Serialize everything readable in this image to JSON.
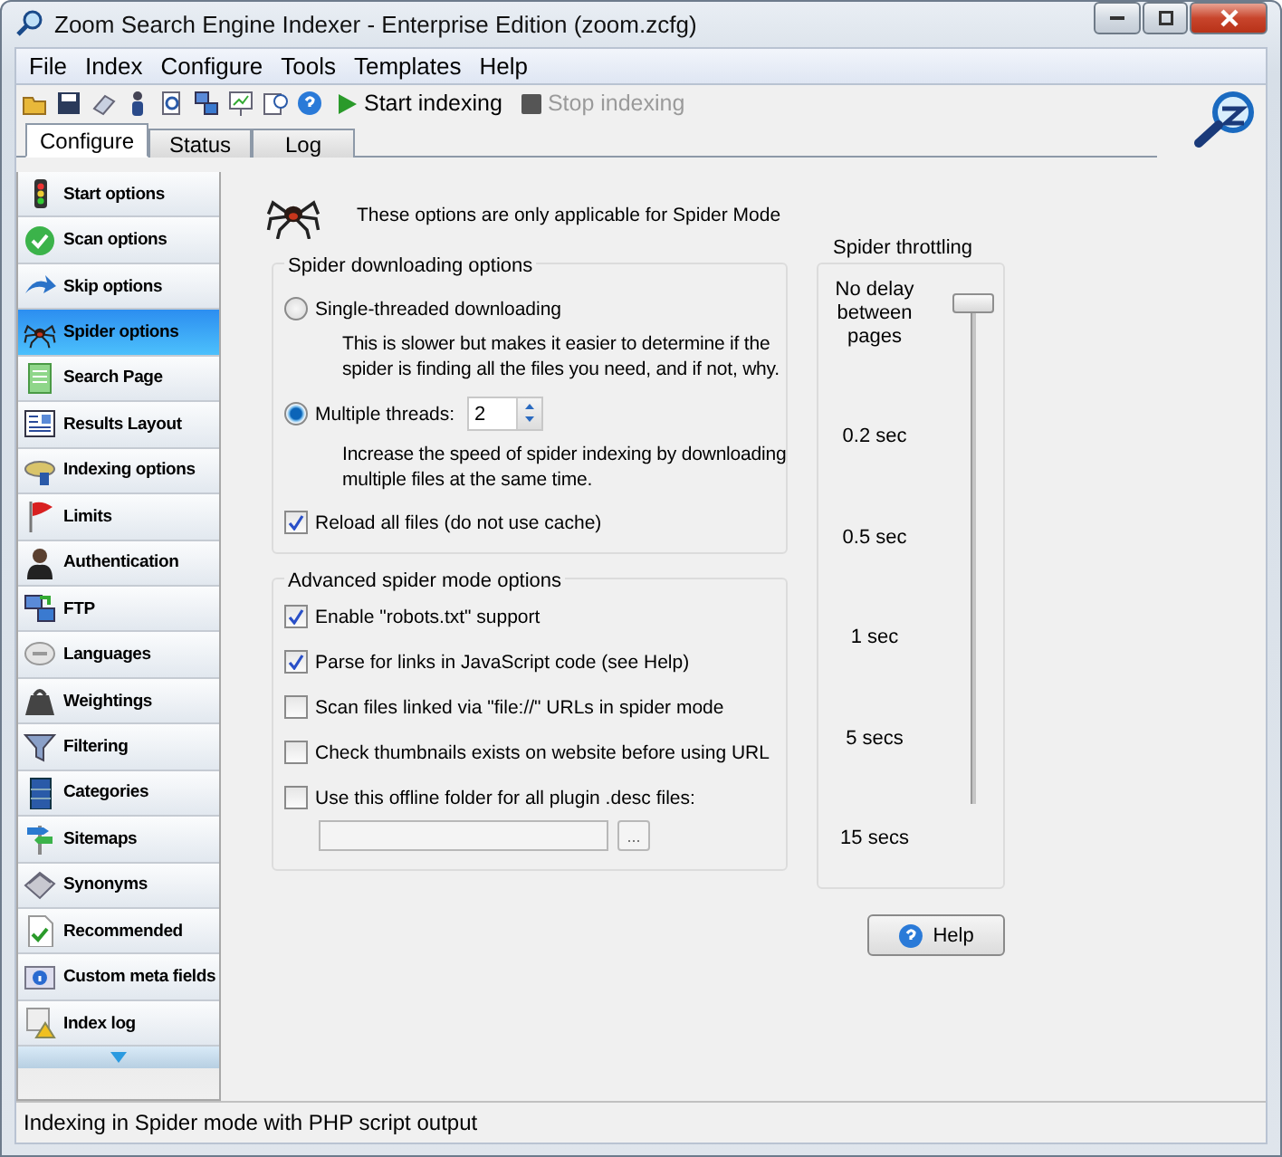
{
  "window": {
    "title": "Zoom Search Engine Indexer - Enterprise Edition (zoom.zcfg)"
  },
  "menu": [
    "File",
    "Index",
    "Configure",
    "Tools",
    "Templates",
    "Help"
  ],
  "toolbar": {
    "start": {
      "label": "Start indexing",
      "disabled": false
    },
    "stop": {
      "label": "Stop indexing",
      "disabled": true
    }
  },
  "tabs": [
    {
      "label": "Configure",
      "selected": true
    },
    {
      "label": "Status",
      "selected": false
    },
    {
      "label": "Log",
      "selected": false
    }
  ],
  "sidebar": {
    "items": [
      {
        "label": "Start options",
        "selected": false
      },
      {
        "label": "Scan options",
        "selected": false
      },
      {
        "label": "Skip options",
        "selected": false
      },
      {
        "label": "Spider options",
        "selected": true
      },
      {
        "label": "Search Page",
        "selected": false
      },
      {
        "label": "Results Layout",
        "selected": false
      },
      {
        "label": "Indexing options",
        "selected": false
      },
      {
        "label": "Limits",
        "selected": false
      },
      {
        "label": "Authentication",
        "selected": false
      },
      {
        "label": "FTP",
        "selected": false
      },
      {
        "label": "Languages",
        "selected": false
      },
      {
        "label": "Weightings",
        "selected": false
      },
      {
        "label": "Filtering",
        "selected": false
      },
      {
        "label": "Categories",
        "selected": false
      },
      {
        "label": "Sitemaps",
        "selected": false
      },
      {
        "label": "Synonyms",
        "selected": false
      },
      {
        "label": "Recommended",
        "selected": false
      },
      {
        "label": "Custom meta fields",
        "selected": false
      },
      {
        "label": "Index log",
        "selected": false
      }
    ]
  },
  "notice": "These options are only applicable for Spider Mode",
  "downloading": {
    "title": "Spider downloading options",
    "options": [
      {
        "label": "Single-threaded downloading",
        "selected": false,
        "description": "This is slower but makes it easier to determine if the spider is finding all the files you need, and if not, why."
      },
      {
        "label": "Multiple threads:",
        "selected": true,
        "threads": "2",
        "description": "Increase the speed of spider indexing by downloading multiple files at the same time."
      }
    ],
    "reload": {
      "label": "Reload all files (do not use cache)",
      "checked": true
    }
  },
  "advanced": {
    "title": "Advanced spider mode options",
    "checkboxes": [
      {
        "label": "Enable \"robots.txt\" support",
        "checked": true
      },
      {
        "label": "Parse for links in JavaScript code (see Help)",
        "checked": true
      },
      {
        "label": "Scan files linked via \"file://\" URLs in spider mode",
        "checked": false
      },
      {
        "label": "Check thumbnails exists on website before using URL",
        "checked": false
      },
      {
        "label": "Use this offline folder for all plugin .desc files:",
        "checked": false
      }
    ],
    "browse": "..."
  },
  "throttling": {
    "title": "Spider throttling",
    "marks": [
      "No delay between pages",
      "0.2 sec",
      "0.5 sec",
      "1 sec",
      "5 secs",
      "15 secs"
    ],
    "level": 0
  },
  "help": "Help",
  "status_bar": "Indexing in Spider mode with PHP script output"
}
